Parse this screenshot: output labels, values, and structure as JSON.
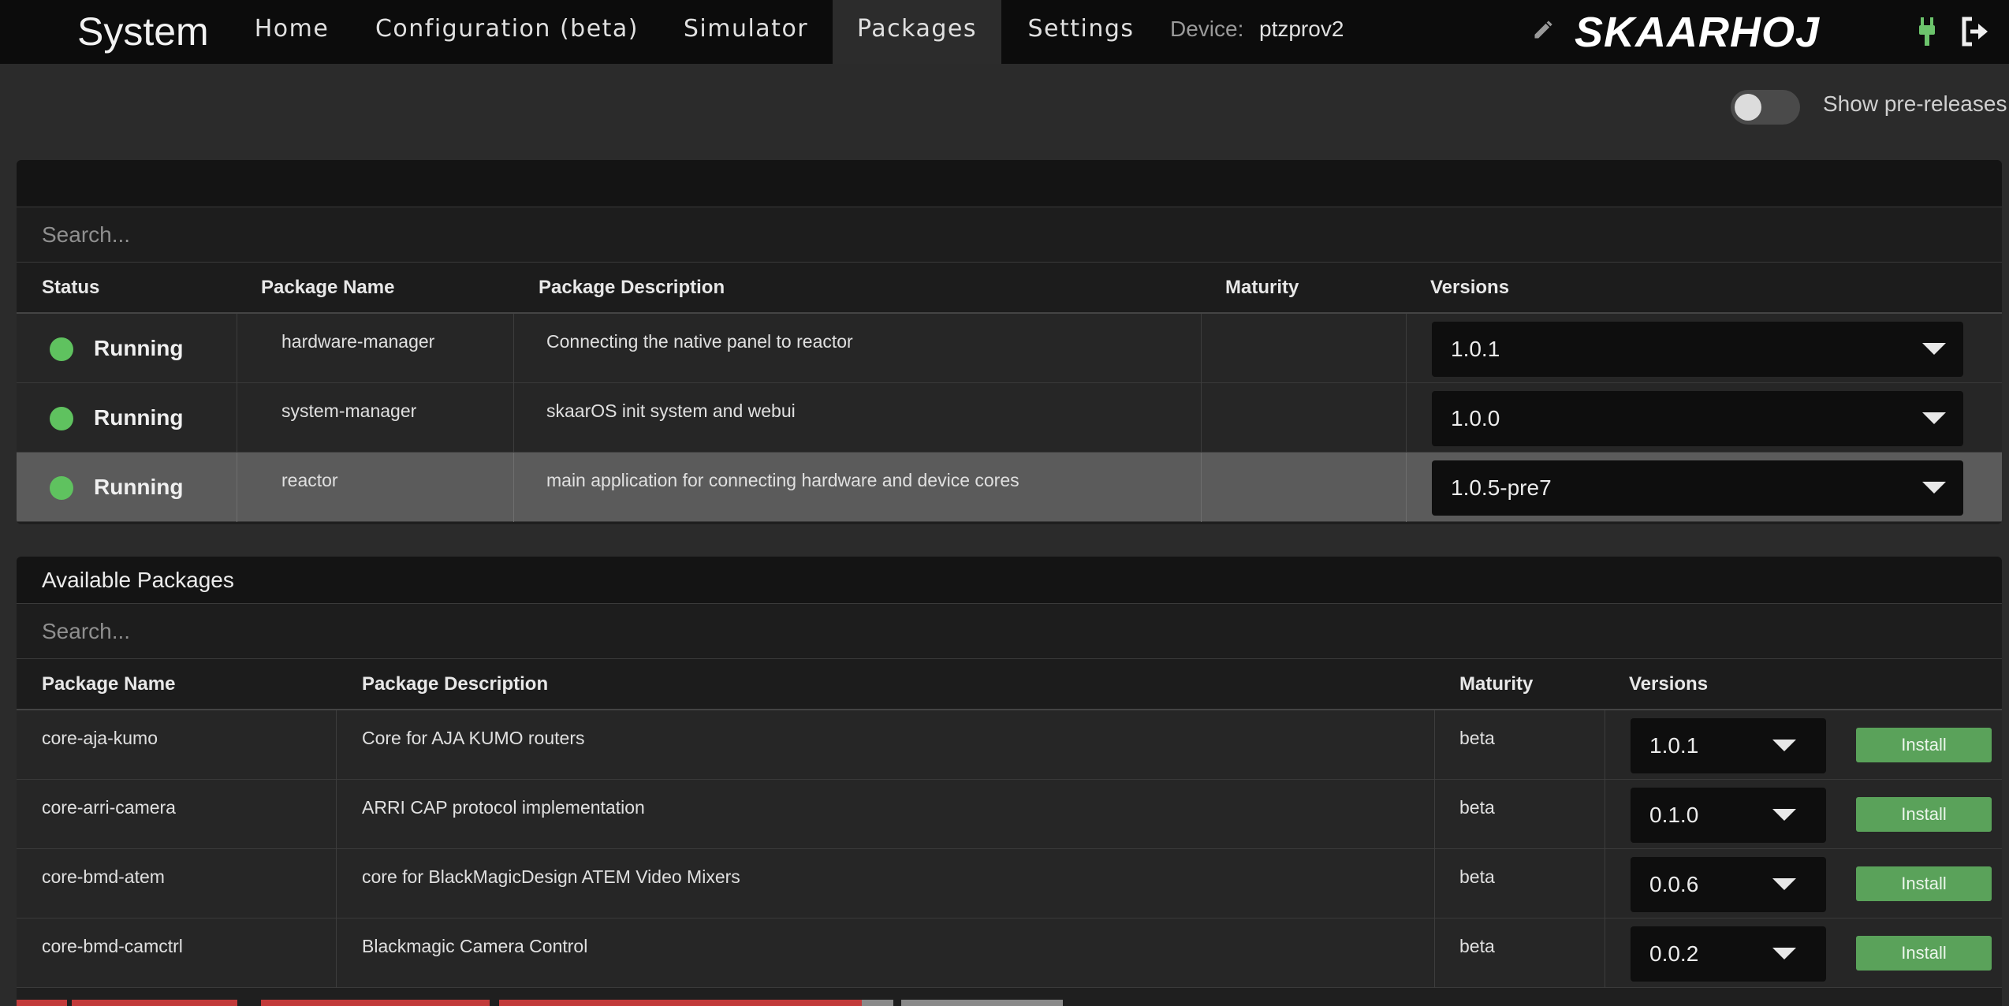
{
  "nav": {
    "title": "System",
    "tabs": [
      {
        "label": "Home"
      },
      {
        "label": "Configuration (beta)"
      },
      {
        "label": "Simulator"
      },
      {
        "label": "Packages"
      },
      {
        "label": "Settings"
      }
    ],
    "active_tab": "Packages",
    "device_label": "Device:",
    "device_name": "ptzprov2",
    "logo": "SKAARHOJ",
    "icons": [
      "pencil-icon",
      "plug-icon",
      "logout-icon"
    ]
  },
  "prerelease_toggle": {
    "label": "Show pre-releases",
    "enabled": false
  },
  "installed": {
    "search_placeholder": "Search...",
    "columns": {
      "status": "Status",
      "name": "Package Name",
      "description": "Package Description",
      "maturity": "Maturity",
      "versions": "Versions"
    },
    "rows": [
      {
        "status": "Running",
        "name": "hardware-manager",
        "description": "Connecting the native panel to reactor",
        "maturity": "",
        "version": "1.0.1"
      },
      {
        "status": "Running",
        "name": "system-manager",
        "description": "skaarOS init system and webui",
        "maturity": "",
        "version": "1.0.0"
      },
      {
        "status": "Running",
        "name": "reactor",
        "description": "main application for connecting hardware and device cores",
        "maturity": "",
        "version": "1.0.5-pre7"
      }
    ]
  },
  "available": {
    "title": "Available Packages",
    "search_placeholder": "Search...",
    "columns": {
      "name": "Package Name",
      "description": "Package Description",
      "maturity": "Maturity",
      "versions": "Versions"
    },
    "install_label": "Install",
    "rows": [
      {
        "name": "core-aja-kumo",
        "description": "Core for AJA KUMO routers",
        "maturity": "beta",
        "version": "1.0.1"
      },
      {
        "name": "core-arri-camera",
        "description": "ARRI CAP protocol implementation",
        "maturity": "beta",
        "version": "0.1.0"
      },
      {
        "name": "core-bmd-atem",
        "description": "core for BlackMagicDesign ATEM Video Mixers",
        "maturity": "beta",
        "version": "0.0.6"
      },
      {
        "name": "core-bmd-camctrl",
        "description": "Blackmagic Camera Control",
        "maturity": "beta",
        "version": "0.0.2"
      }
    ]
  },
  "colors": {
    "running": "#5fc25f",
    "install_button": "#5aa25a",
    "navbar": "#0c0c0c",
    "background": "#2b2b2b",
    "highlight_row": "#5b5b5b"
  }
}
